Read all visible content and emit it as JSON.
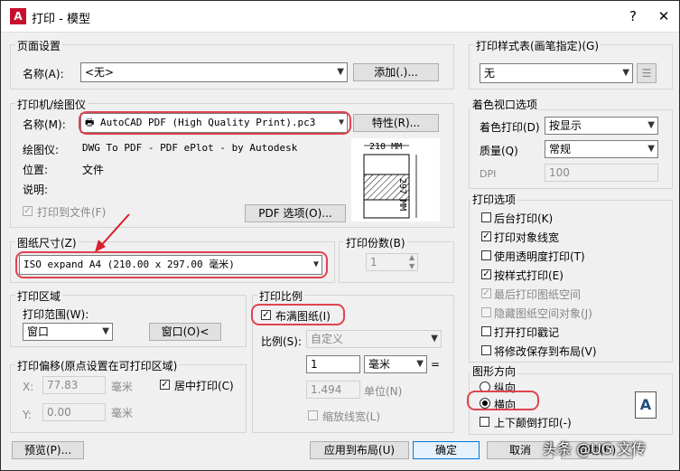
{
  "window": {
    "title": "打印 - 模型",
    "help": "?",
    "close": "✕"
  },
  "page_setup": {
    "group": "页面设置",
    "name_label": "名称(A):",
    "name_value": "<无>",
    "add_button": "添加(.)..."
  },
  "printer": {
    "group": "打印机/绘图仪",
    "name_label": "名称(M):",
    "name_value": "AutoCAD PDF (High Quality Print).pc3",
    "properties_button": "特性(R)...",
    "plotter_label": "绘图仪:",
    "plotter_value": "DWG To PDF - PDF ePlot - by Autodesk",
    "location_label": "位置:",
    "location_value": "文件",
    "desc_label": "说明:",
    "print_to_file": "打印到文件(F)",
    "pdf_options_button": "PDF 选项(O)...",
    "preview_width": "210 MM",
    "preview_height": "297 MM"
  },
  "paper_size": {
    "group": "图纸尺寸(Z)",
    "value": "ISO expand A4 (210.00 x 297.00 毫米)"
  },
  "copies": {
    "group": "打印份数(B)",
    "value": "1"
  },
  "plot_area": {
    "group": "打印区域",
    "range_label": "打印范围(W):",
    "range_value": "窗口",
    "window_button": "窗口(O)<"
  },
  "plot_offset": {
    "group": "打印偏移(原点设置在可打印区域)",
    "x_label": "X:",
    "x_value": "77.83",
    "x_unit": "毫米",
    "y_label": "Y:",
    "y_value": "0.00",
    "y_unit": "毫米",
    "center": "居中打印(C)"
  },
  "plot_scale": {
    "group": "打印比例",
    "fit": "布满图纸(I)",
    "scale_label": "比例(S):",
    "scale_value": "自定义",
    "num1": "1",
    "unit1": "毫米",
    "equals": "=",
    "num2": "1.494",
    "unit2": "单位(N)",
    "lineweight": "缩放线宽(L)"
  },
  "style_table": {
    "group": "打印样式表(画笔指定)(G)",
    "value": "无"
  },
  "shaded": {
    "group": "着色视口选项",
    "shade_label": "着色打印(D)",
    "shade_value": "按显示",
    "quality_label": "质量(Q)",
    "quality_value": "常规",
    "dpi_label": "DPI",
    "dpi_value": "100"
  },
  "options": {
    "group": "打印选项",
    "items": [
      "后台打印(K)",
      "打印对象线宽",
      "使用透明度打印(T)",
      "按样式打印(E)",
      "最后打印图纸空间",
      "隐藏图纸空间对象(J)",
      "打开打印戳记",
      "将修改保存到布局(V)"
    ]
  },
  "orientation": {
    "group": "图形方向",
    "portrait": "纵向",
    "landscape": "横向",
    "upside_down": "上下颠倒打印(-)",
    "icon_letter": "A"
  },
  "footer": {
    "preview": "预览(P)...",
    "apply": "应用到布局(U)",
    "ok": "确定",
    "cancel": "取消",
    "help": "帮助(H)"
  },
  "watermark": "头条 @UG 文传"
}
